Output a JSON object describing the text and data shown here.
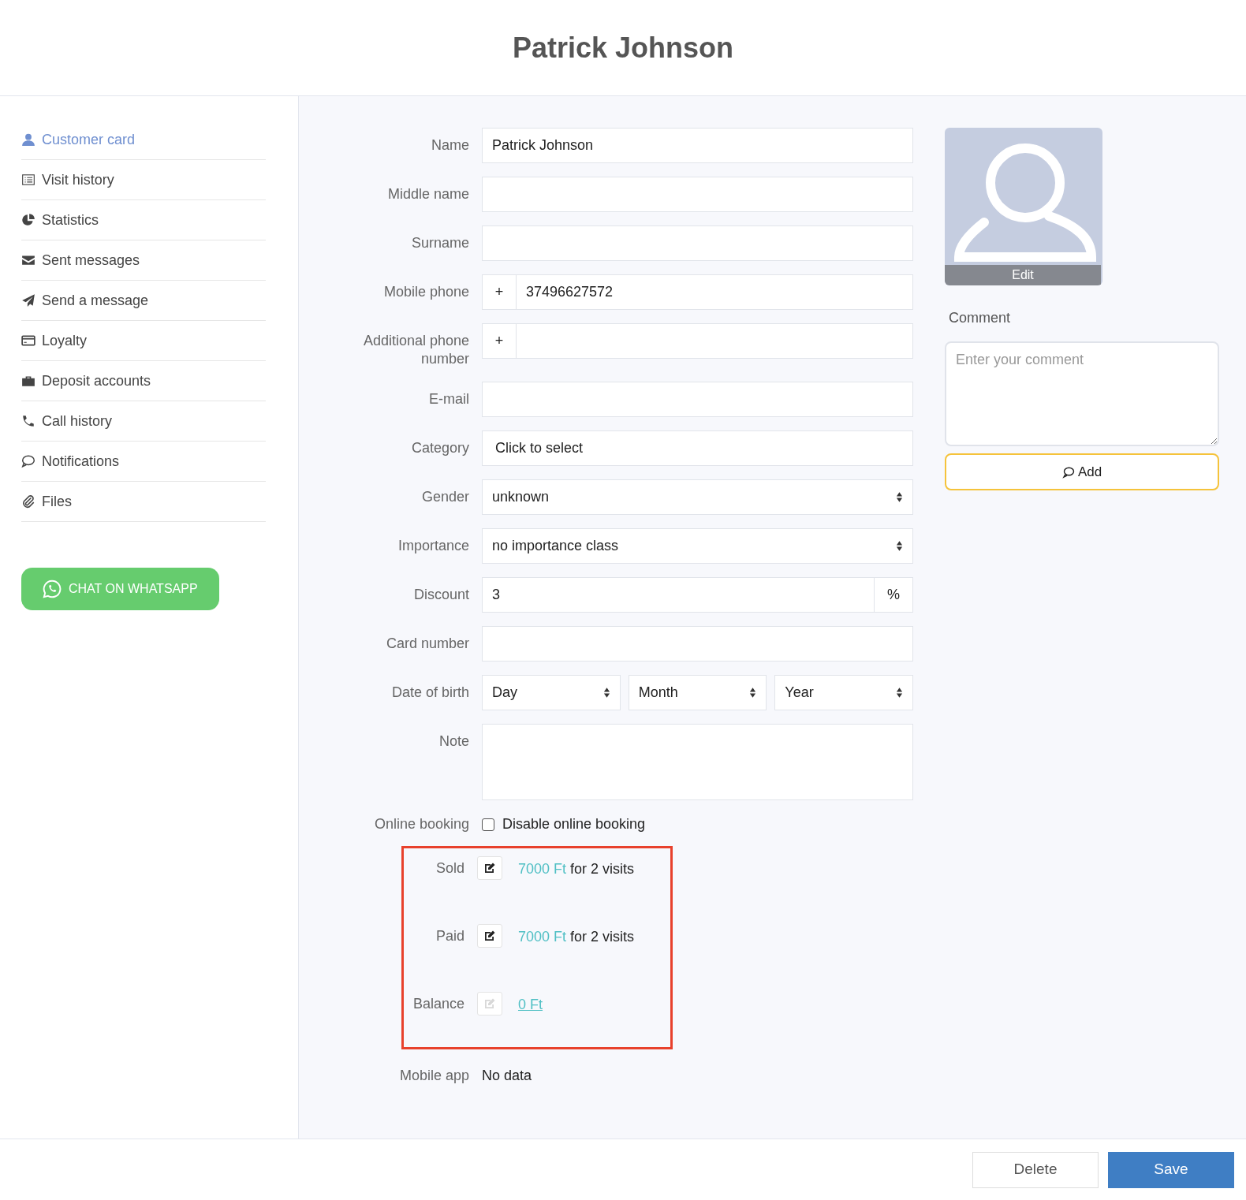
{
  "title": "Patrick Johnson",
  "sidebar": {
    "items": [
      {
        "label": "Customer card",
        "selected": true
      },
      {
        "label": "Visit history",
        "selected": false
      },
      {
        "label": "Statistics",
        "selected": false
      },
      {
        "label": "Sent messages",
        "selected": false
      },
      {
        "label": "Send a message",
        "selected": false
      },
      {
        "label": "Loyalty",
        "selected": false
      },
      {
        "label": "Deposit accounts",
        "selected": false
      },
      {
        "label": "Call history",
        "selected": false
      },
      {
        "label": "Notifications",
        "selected": false
      },
      {
        "label": "Files",
        "selected": false
      }
    ],
    "whatsapp_button": "CHAT ON WHATSAPP"
  },
  "form": [
    {
      "kind": "text",
      "label": "Name",
      "value": "Patrick Johnson"
    },
    {
      "kind": "text",
      "label": "Middle name"
    },
    {
      "kind": "text",
      "label": "Surname"
    },
    {
      "kind": "phone",
      "label": "Mobile phone",
      "prefix": "+",
      "value": "37496627572"
    },
    {
      "kind": "phone",
      "label": "Additional phone number",
      "prefix": "+"
    },
    {
      "kind": "text",
      "label": "E-mail"
    },
    {
      "kind": "picker",
      "label": "Category",
      "value": "Click to select"
    },
    {
      "kind": "select",
      "label": "Gender",
      "value": "unknown"
    },
    {
      "kind": "select",
      "label": "Importance",
      "value": "no importance class"
    },
    {
      "kind": "suffix",
      "label": "Discount",
      "value": "3",
      "suffix": "%"
    },
    {
      "kind": "text",
      "label": "Card number"
    },
    {
      "kind": "date",
      "label": "Date of birth",
      "parts": [
        "Day",
        "Month",
        "Year"
      ]
    },
    {
      "kind": "textarea",
      "label": "Note"
    },
    {
      "kind": "checkbox",
      "label": "Online booking",
      "text": "Disable online booking",
      "checked": false
    }
  ],
  "finance": [
    {
      "label": "Sold",
      "edit_disabled": false,
      "amount": "7000 Ft",
      "underlined": false,
      "suffix": "for 2 visits"
    },
    {
      "label": "Paid",
      "edit_disabled": false,
      "amount": "7000 Ft",
      "underlined": false,
      "suffix": "for 2 visits"
    },
    {
      "label": "Balance",
      "edit_disabled": true,
      "amount": "0 Ft",
      "underlined": true
    }
  ],
  "mobile_app": {
    "label": "Mobile app",
    "value": "No data"
  },
  "photo": {
    "edit": "Edit"
  },
  "comment": {
    "label": "Comment",
    "placeholder": "Enter your comment",
    "add_button": "Add"
  },
  "footer": {
    "delete": "Delete",
    "save": "Save"
  }
}
